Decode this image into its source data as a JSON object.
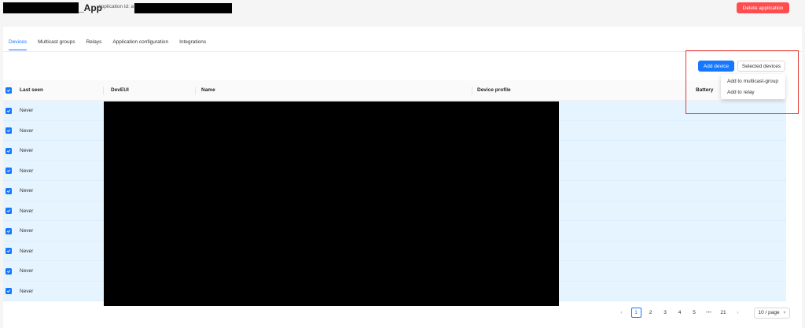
{
  "header": {
    "app_title": "_App",
    "app_id_label": "application id: a",
    "delete_label": "Delete application"
  },
  "tabs": [
    {
      "label": "Devices",
      "active": true
    },
    {
      "label": "Multicast groups",
      "active": false
    },
    {
      "label": "Relays",
      "active": false
    },
    {
      "label": "Application configuration",
      "active": false
    },
    {
      "label": "Integrations",
      "active": false
    }
  ],
  "toolbar": {
    "add_device_label": "Add device",
    "selected_devices_label": "Selected devices"
  },
  "dropdown": {
    "items": [
      "Add to multicast-group",
      "Add to relay"
    ]
  },
  "table": {
    "columns": [
      "Last seen",
      "DevEUI",
      "Name",
      "Device profile",
      "Battery"
    ],
    "rows": [
      {
        "checked": true,
        "last_seen": "Never"
      },
      {
        "checked": true,
        "last_seen": "Never"
      },
      {
        "checked": true,
        "last_seen": "Never"
      },
      {
        "checked": true,
        "last_seen": "Never"
      },
      {
        "checked": true,
        "last_seen": "Never"
      },
      {
        "checked": true,
        "last_seen": "Never"
      },
      {
        "checked": true,
        "last_seen": "Never"
      },
      {
        "checked": true,
        "last_seen": "Never"
      },
      {
        "checked": true,
        "last_seen": "Never"
      },
      {
        "checked": true,
        "last_seen": "Never"
      }
    ]
  },
  "pagination": {
    "prev_icon": "chevron-left-icon",
    "pages": [
      "1",
      "2",
      "3",
      "4",
      "5"
    ],
    "ellipsis": "•••",
    "last_page": "21",
    "next_icon": "chevron-right-icon",
    "current": "1",
    "page_size": "10 / page"
  },
  "colors": {
    "primary": "#1677ff",
    "danger": "#ff4d4f",
    "row_selected": "#e6f4ff",
    "annotation": "#e53935"
  }
}
